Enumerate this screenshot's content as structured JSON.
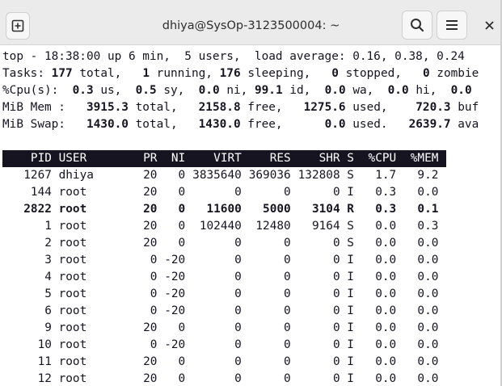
{
  "window": {
    "title": "dhiya@SysOp-3123500004: ~",
    "icons": {
      "new_tab": "new-tab-icon",
      "search": "search-icon",
      "menu": "hamburger-menu-icon",
      "close": "close-icon"
    }
  },
  "summary": {
    "line1": "top - 18:38:00 up 6 min,  5 users,  load average: 0.16, 0.38, 0.24",
    "tasks": {
      "label": "Tasks:",
      "total": "177",
      "total_label": "total,",
      "running": "1",
      "running_label": "running,",
      "sleeping": "176",
      "sleeping_label": "sleeping,",
      "stopped": "0",
      "stopped_label": "stopped,",
      "zombie": "0",
      "zombie_label": "zombie"
    },
    "cpu": {
      "label": "%Cpu(s):",
      "us": "0.3",
      "us_label": "us,",
      "sy": "0.5",
      "sy_label": "sy,",
      "ni": "0.0",
      "ni_label": "ni,",
      "id": "99.1",
      "id_label": "id,",
      "wa": "0.0",
      "wa_label": "wa,",
      "hi": "0.0",
      "hi_label": "hi,",
      "si": "0.0"
    },
    "mem": {
      "label": "MiB Mem :",
      "total": "3915.3",
      "total_label": "total,",
      "free": "2158.8",
      "free_label": "free,",
      "used": "1275.6",
      "used_label": "used,",
      "buff": "720.3",
      "buff_label": "buf"
    },
    "swap": {
      "label": "MiB Swap:",
      "total": "1430.0",
      "total_label": "total,",
      "free": "1430.0",
      "free_label": "free,",
      "used": "0.0",
      "used_label": "used.",
      "avail": "2639.7",
      "avail_label": "ava"
    }
  },
  "table": {
    "columns": [
      "PID",
      "USER",
      "PR",
      "NI",
      "VIRT",
      "RES",
      "SHR",
      "S",
      "%CPU",
      "%MEM"
    ],
    "rows": [
      [
        "1267",
        "dhiya",
        "20",
        "0",
        "3835640",
        "369036",
        "132808",
        "S",
        "1.7",
        "9.2"
      ],
      [
        "144",
        "root",
        "20",
        "0",
        "0",
        "0",
        "0",
        "I",
        "0.3",
        "0.0"
      ],
      [
        "2822",
        "root",
        "20",
        "0",
        "11600",
        "5000",
        "3104",
        "R",
        "0.3",
        "0.1"
      ],
      [
        "1",
        "root",
        "20",
        "0",
        "102440",
        "12480",
        "9164",
        "S",
        "0.0",
        "0.3"
      ],
      [
        "2",
        "root",
        "20",
        "0",
        "0",
        "0",
        "0",
        "S",
        "0.0",
        "0.0"
      ],
      [
        "3",
        "root",
        "0",
        "-20",
        "0",
        "0",
        "0",
        "I",
        "0.0",
        "0.0"
      ],
      [
        "4",
        "root",
        "0",
        "-20",
        "0",
        "0",
        "0",
        "I",
        "0.0",
        "0.0"
      ],
      [
        "5",
        "root",
        "0",
        "-20",
        "0",
        "0",
        "0",
        "I",
        "0.0",
        "0.0"
      ],
      [
        "6",
        "root",
        "0",
        "-20",
        "0",
        "0",
        "0",
        "I",
        "0.0",
        "0.0"
      ],
      [
        "9",
        "root",
        "20",
        "0",
        "0",
        "0",
        "0",
        "I",
        "0.0",
        "0.0"
      ],
      [
        "10",
        "root",
        "0",
        "-20",
        "0",
        "0",
        "0",
        "I",
        "0.0",
        "0.0"
      ],
      [
        "11",
        "root",
        "20",
        "0",
        "0",
        "0",
        "0",
        "I",
        "0.0",
        "0.0"
      ],
      [
        "12",
        "root",
        "20",
        "0",
        "0",
        "0",
        "0",
        "I",
        "0.0",
        "0.0"
      ]
    ],
    "highlighted_row": 2
  }
}
